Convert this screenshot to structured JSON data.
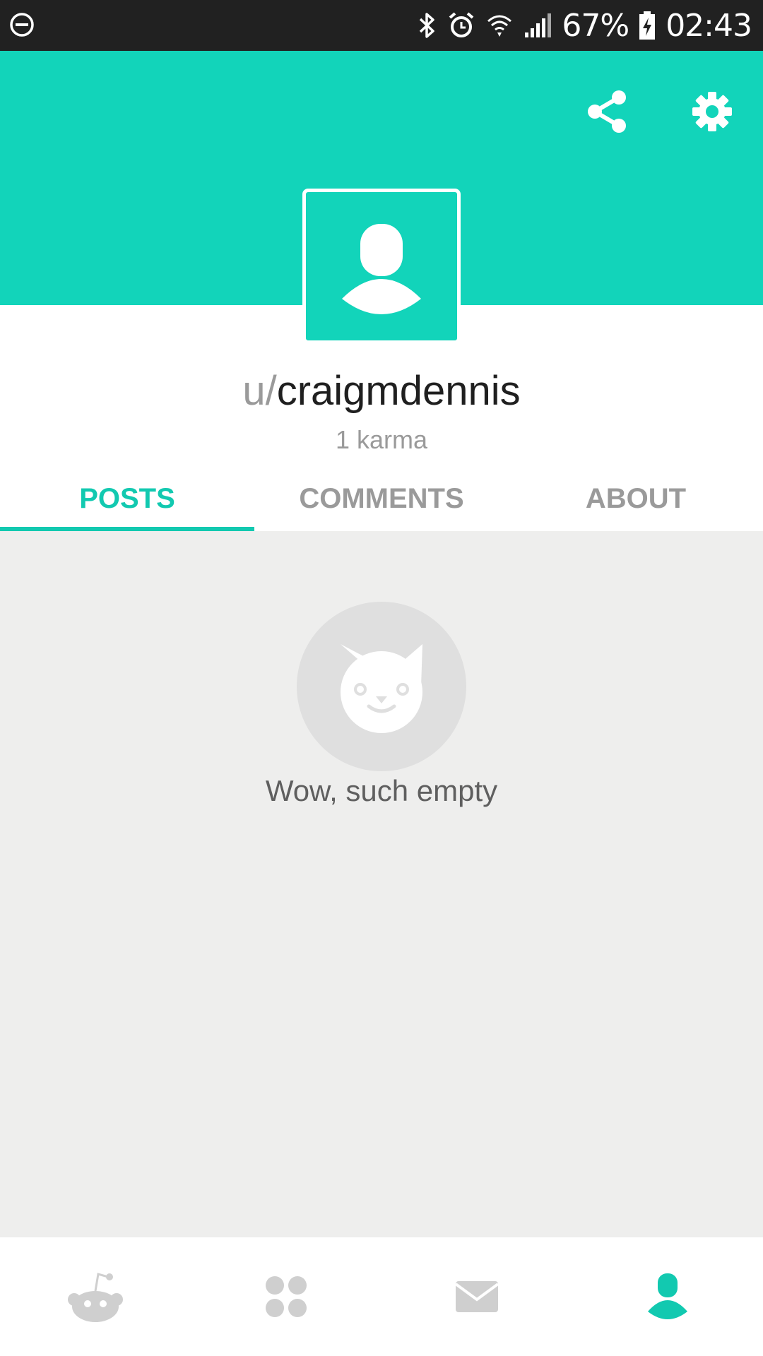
{
  "status_bar": {
    "battery": "67%",
    "time": "02:43",
    "icons": [
      "do-not-disturb-icon",
      "bluetooth-icon",
      "alarm-icon",
      "wifi-icon",
      "signal-icon",
      "battery-charging-icon"
    ]
  },
  "header": {
    "background_color": "#12d4ba",
    "actions": [
      {
        "name": "share",
        "icon": "share-icon"
      },
      {
        "name": "settings",
        "icon": "gear-icon"
      }
    ]
  },
  "profile": {
    "username_prefix": "u/",
    "username": "craigmdennis",
    "karma": "1 karma",
    "avatar_icon": "user-avatar-icon"
  },
  "tabs": [
    {
      "label": "POSTS",
      "active": true
    },
    {
      "label": "COMMENTS",
      "active": false
    },
    {
      "label": "ABOUT",
      "active": false
    }
  ],
  "empty_state": {
    "icon": "cat-face-icon",
    "text": "Wow, such empty"
  },
  "bottom_nav": [
    {
      "name": "home",
      "icon": "reddit-alien-icon",
      "active": false
    },
    {
      "name": "communities",
      "icon": "grid-dots-icon",
      "active": false
    },
    {
      "name": "inbox",
      "icon": "envelope-icon",
      "active": false
    },
    {
      "name": "profile",
      "icon": "user-icon",
      "active": true
    }
  ],
  "colors": {
    "accent": "#12d4ba",
    "active_tab": "#12c9b0",
    "inactive": "#9a9a9a",
    "content_background": "#eeeeed"
  }
}
